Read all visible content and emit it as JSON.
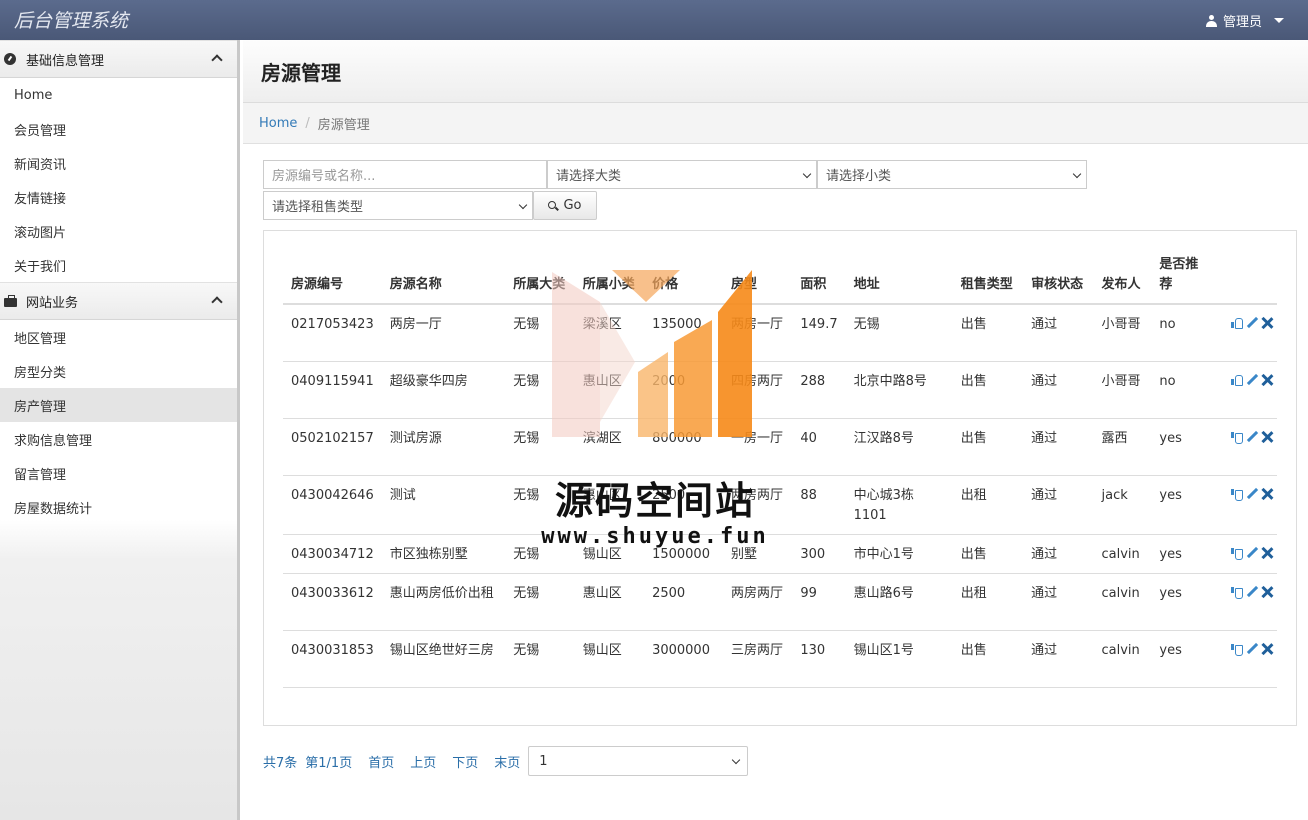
{
  "app": {
    "title": "后台管理系统",
    "user_label": "管理员"
  },
  "sidebar": {
    "groups": [
      {
        "title": "基础信息管理",
        "items": [
          "Home",
          "会员管理",
          "新闻资讯",
          "友情链接",
          "滚动图片",
          "关于我们"
        ]
      },
      {
        "title": "网站业务",
        "items": [
          "地区管理",
          "房型分类",
          "房产管理",
          "求购信息管理",
          "留言管理",
          "房屋数据统计"
        ]
      }
    ],
    "active_item": "房产管理"
  },
  "page": {
    "title": "房源管理",
    "breadcrumb": {
      "home": "Home",
      "current": "房源管理"
    }
  },
  "filters": {
    "keyword_placeholder": "房源编号或名称...",
    "category_select": "请选择大类",
    "subcategory_select": "请选择小类",
    "sale_type_select": "请选择租售类型",
    "go_label": "Go"
  },
  "table": {
    "headers": [
      "房源编号",
      "房源名称",
      "所属大类",
      "所属小类",
      "价格",
      "房型",
      "面积",
      "地址",
      "租售类型",
      "审核状态",
      "发布人",
      "是否推荐"
    ],
    "rows": [
      [
        "0217053423",
        "两房一厅",
        "无锡",
        "梁溪区",
        "135000",
        "两房一厅",
        "149.7",
        "无锡",
        "出售",
        "通过",
        "小哥哥",
        "no"
      ],
      [
        "0409115941",
        "超级豪华四房",
        "无锡",
        "惠山区",
        "2000",
        "四房两厅",
        "288",
        "北京中路8号",
        "出售",
        "通过",
        "小哥哥",
        "no"
      ],
      [
        "0502102157",
        "测试房源",
        "无锡",
        "滨湖区",
        "800000",
        "一房一厅",
        "40",
        "江汉路8号",
        "出售",
        "通过",
        "露西",
        "yes"
      ],
      [
        "0430042646",
        "测试",
        "无锡",
        "惠山区",
        "2500",
        "两房两厅",
        "88",
        "中心城3栋1101",
        "出租",
        "通过",
        "jack",
        "yes"
      ],
      [
        "0430034712",
        "市区独栋别墅",
        "无锡",
        "锡山区",
        "1500000",
        "别墅",
        "300",
        "市中心1号",
        "出售",
        "通过",
        "calvin",
        "yes"
      ],
      [
        "0430033612",
        "惠山两房低价出租",
        "无锡",
        "惠山区",
        "2500",
        "两房两厅",
        "99",
        "惠山路6号",
        "出租",
        "通过",
        "calvin",
        "yes"
      ],
      [
        "0430031853",
        "锡山区绝世好三房",
        "无锡",
        "锡山区",
        "3000000",
        "三房两厅",
        "130",
        "锡山区1号",
        "出售",
        "通过",
        "calvin",
        "yes"
      ]
    ]
  },
  "pager": {
    "total": "共7条",
    "page_info": "第1/1页",
    "first": "首页",
    "prev": "上页",
    "next": "下页",
    "last": "末页",
    "page_select": "1"
  },
  "watermark": {
    "text": "源码空间站",
    "url": "www.shuyue.fun"
  },
  "colors": {
    "topbar": "#4f5e80",
    "link": "#337ab7",
    "action_icon": "#3a87c8",
    "watermark_orange": "#f7a23c"
  }
}
